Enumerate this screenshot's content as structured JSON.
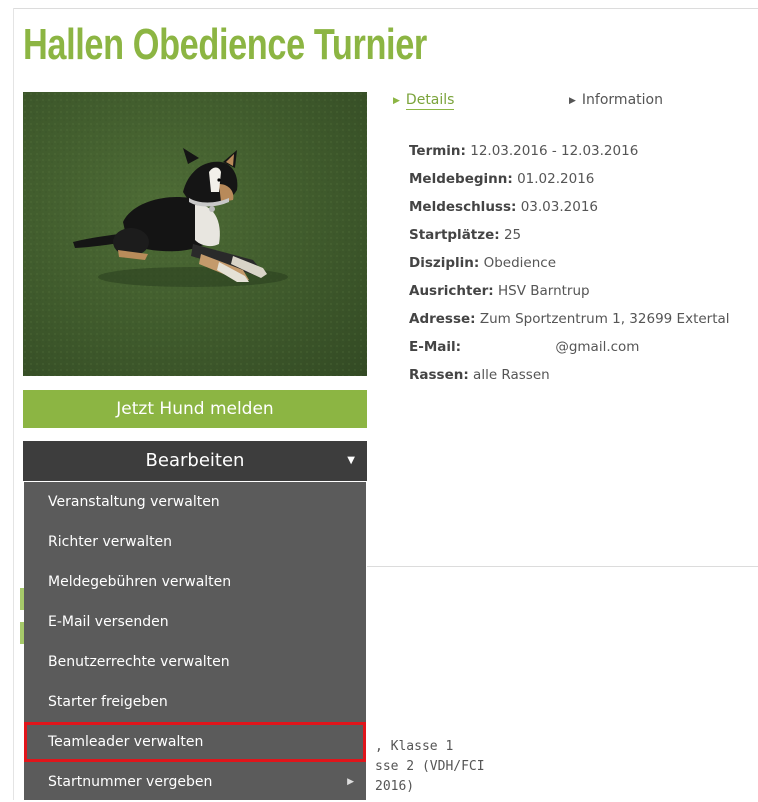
{
  "page": {
    "title": "Hallen Obedience Turnier"
  },
  "tabs": [
    {
      "label": "Details",
      "active": true
    },
    {
      "label": "Information",
      "active": false
    }
  ],
  "details": [
    {
      "key": "Termin:",
      "value": "12.03.2016 - 12.03.2016"
    },
    {
      "key": "Meldebeginn:",
      "value": "01.02.2016"
    },
    {
      "key": "Meldeschluss:",
      "value": "03.03.2016"
    },
    {
      "key": "Startplätze:",
      "value": "25"
    },
    {
      "key": "Disziplin:",
      "value": "Obedience"
    },
    {
      "key": "Ausrichter:",
      "value": "HSV Barntrup"
    },
    {
      "key": "Adresse:",
      "value": "Zum Sportzentrum 1, 32699 Extertal"
    },
    {
      "key": "E-Mail:",
      "value": "@gmail.com"
    },
    {
      "key": "Rassen:",
      "value": "alle Rassen"
    }
  ],
  "buttons": {
    "melden": "Jetzt Hund melden",
    "bearbeiten": "Bearbeiten"
  },
  "dropdown": {
    "items": [
      {
        "label": "Veranstaltung verwalten"
      },
      {
        "label": "Richter verwalten"
      },
      {
        "label": "Meldegebühren verwalten"
      },
      {
        "label": "E-Mail versenden"
      },
      {
        "label": "Benutzerrechte verwalten"
      },
      {
        "label": "Starter freigeben"
      },
      {
        "label": "Teamleader verwalten",
        "highlighted": true
      },
      {
        "label": "Startnummer vergeben",
        "has_submenu": true
      }
    ]
  },
  "obscured_text": [
    ", Klasse 1",
    "sse 2 (VDH/FCI",
    "2016)"
  ],
  "colors": {
    "accent_green": "#8cb543",
    "dark_button": "#3d3d3d",
    "menu_bg": "#5b5b5b",
    "highlight_red": "#e0151b"
  },
  "icons": {
    "tab_arrow": "triangle-right-icon",
    "dropdown_caret": "caret-down-icon",
    "submenu_arrow": "triangle-right-icon"
  }
}
